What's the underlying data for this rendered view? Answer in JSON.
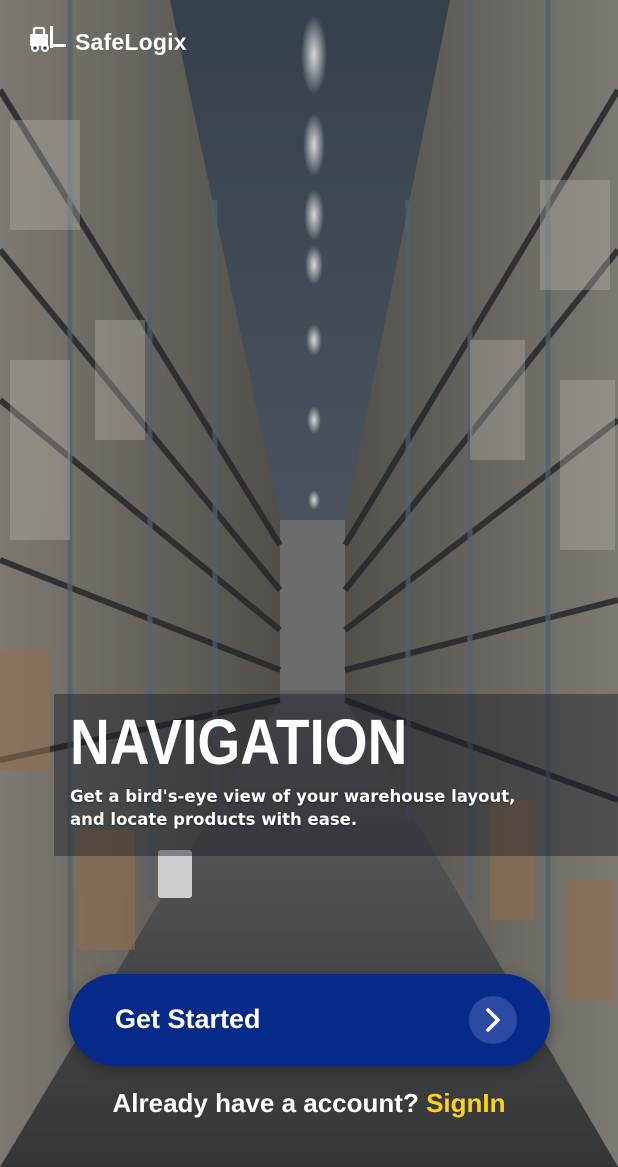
{
  "brand": {
    "name": "SafeLogix",
    "icon": "forklift-icon"
  },
  "hero": {
    "title": "NAVIGATION",
    "subtitle": "Get a bird's-eye view of your warehouse layout, and locate products with ease."
  },
  "cta": {
    "label": "Get Started",
    "icon": "chevron-right-icon"
  },
  "signin": {
    "prompt": "Already have a account?",
    "link": "SignIn"
  },
  "colors": {
    "primary": "#062a8a",
    "accent": "#ffd21a",
    "text": "#ffffff"
  }
}
